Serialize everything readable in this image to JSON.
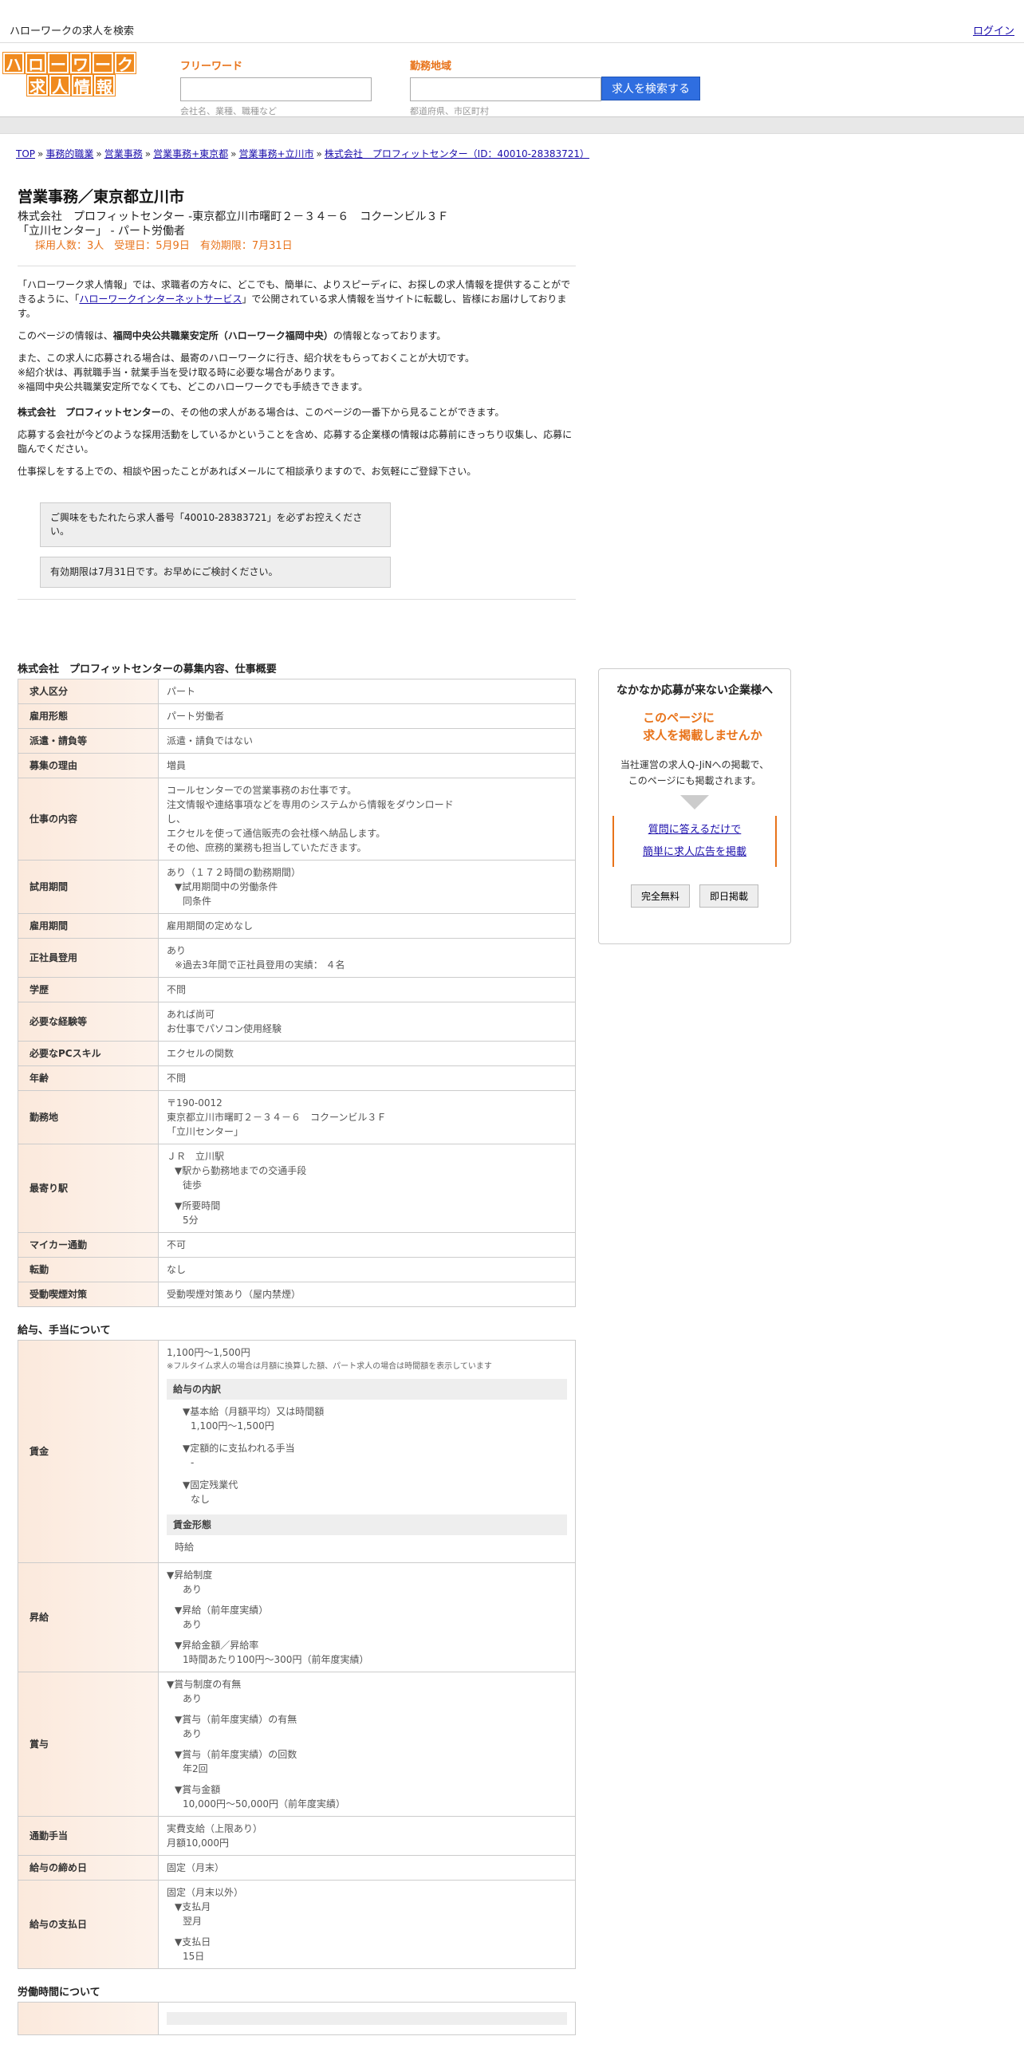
{
  "top": {
    "title": "ハローワークの求人を検索",
    "login": "ログイン"
  },
  "logo": {
    "row1": [
      "ハ",
      "ロ",
      "ー",
      "ワ",
      "ー",
      "ク"
    ],
    "row2": [
      "求",
      "人",
      "情",
      "報"
    ]
  },
  "search": {
    "free_label": "フリーワード",
    "free_ph": "会社名、業種、職種など",
    "area_label": "勤務地域",
    "area_ph": "都道府県、市区町村",
    "button": "求人を検索する"
  },
  "breadcrumb": [
    "TOP",
    "事務的職業",
    "営業事務",
    "営業事務+東京都",
    "営業事務+立川市",
    "株式会社　プロフィットセンター（ID：40010-28383721）"
  ],
  "job": {
    "title": "営業事務／東京都立川市",
    "sub1": "株式会社　プロフィットセンター -東京都立川市曙町２－３４－６　コクーンビル３Ｆ",
    "sub2": "「立川センター」 - パート労働者",
    "meta": "採用人数：3人　受理日：5月9日　有効期限：7月31日"
  },
  "intro": {
    "p1a": "「ハローワーク求人情報」では、求職者の方々に、どこでも、簡単に、よりスピーディに、お探しの求人情報を提供することができるように、「",
    "p1link": "ハローワークインターネットサービス",
    "p1b": "」で公開されている求人情報を当サイトに転載し、皆様にお届けしております。",
    "p2a": "このページの情報は、",
    "p2b": "福岡中央公共職業安定所（ハローワーク福岡中央）",
    "p2c": "の情報となっております。",
    "p3": [
      "また、この求人に応募される場合は、最寄のハローワークに行き、紹介状をもらっておくことが大切です。",
      "※紹介状は、再就職手当・就業手当を受け取る時に必要な場合があります。",
      "※福岡中央公共職業安定所でなくても、どこのハローワークでも手続きできます。"
    ],
    "p4a": "株式会社　プロフィットセンター",
    "p4b": "の、その他の求人がある場合は、このページの一番下から見ることができます。",
    "p5": "応募する会社が今どのような採用活動をしているかということを含め、応募する企業様の情報は応募前にきっちり収集し、応募に臨んでください。",
    "p6": "仕事探しをする上での、相談や困ったことがあればメールにて相談承りますので、お気軽にご登録下さい。",
    "n1": "ご興味をもたれたら求人番号「40010-28383721」を必ずお控えください。",
    "n2": "有効期限は7月31日です。お早めにご検討ください。"
  },
  "sec1": {
    "title": "株式会社　プロフィットセンターの募集内容、仕事概要",
    "rows": [
      {
        "k": "求人区分",
        "v": [
          "パート"
        ]
      },
      {
        "k": "雇用形態",
        "v": [
          "パート労働者"
        ]
      },
      {
        "k": "派遣・請負等",
        "v": [
          "派遣・請負ではない"
        ]
      },
      {
        "k": "募集の理由",
        "v": [
          "増員"
        ]
      },
      {
        "k": "仕事の内容",
        "v": [
          "コールセンターでの営業事務のお仕事です。",
          "注文情報や連絡事項などを専用のシステムから情報をダウンロード",
          "し、",
          "エクセルを使って通信販売の会社様へ納品します。",
          "その他、庶務的業務も担当していただきます。"
        ]
      },
      {
        "k": "試用期間",
        "v": [
          "あり（１７２時間の勤務期間）",
          "▼試用期間中の労働条件",
          "同条件"
        ]
      },
      {
        "k": "雇用期間",
        "v": [
          "雇用期間の定めなし"
        ]
      },
      {
        "k": "正社員登用",
        "v": [
          "あり",
          "※過去3年間で正社員登用の実績： ４名"
        ]
      },
      {
        "k": "学歴",
        "v": [
          "不問"
        ]
      },
      {
        "k": "必要な経験等",
        "v": [
          "あれば尚可",
          "お仕事でパソコン使用経験"
        ]
      },
      {
        "k": "必要なPCスキル",
        "v": [
          "エクセルの関数"
        ]
      },
      {
        "k": "年齢",
        "v": [
          "不問"
        ]
      },
      {
        "k": "勤務地",
        "v": [
          "〒190-0012",
          "東京都立川市曙町２－３４－６　コクーンビル３Ｆ",
          "「立川センター」"
        ]
      },
      {
        "k": "最寄り駅",
        "v": [
          "ＪＲ　立川駅",
          "▼駅から勤務地までの交通手段",
          "徒歩",
          "▼所要時間",
          "5分"
        ]
      },
      {
        "k": "マイカー通勤",
        "v": [
          "不可"
        ]
      },
      {
        "k": "転勤",
        "v": [
          "なし"
        ]
      },
      {
        "k": "受動喫煙対策",
        "v": [
          "受動喫煙対策あり（屋内禁煙）"
        ]
      }
    ]
  },
  "sec2": {
    "title": "給与、手当について",
    "wage": {
      "k": "賃金",
      "amount": "1,100円〜1,500円",
      "note": "※フルタイム求人の場合は月額に換算した額、パート求人の場合は時間額を表示しています",
      "box1": "給与の内訳",
      "items": [
        "▼基本給（月額平均）又は時間額",
        "1,100円〜1,500円",
        "▼定額的に支払われる手当",
        "-",
        "▼固定残業代",
        "なし"
      ],
      "box2": "賃金形態",
      "form": "時給"
    },
    "raise": {
      "k": "昇給",
      "v": [
        "▼昇給制度",
        "あり",
        "▼昇給（前年度実績）",
        "あり",
        "▼昇給金額／昇給率",
        "1時間あたり100円〜300円（前年度実績）"
      ]
    },
    "bonus": {
      "k": "賞与",
      "v": [
        "▼賞与制度の有無",
        "あり",
        "▼賞与（前年度実績）の有無",
        "あり",
        "▼賞与（前年度実績）の回数",
        "年2回",
        "▼賞与金額",
        "10,000円〜50,000円（前年度実績）"
      ]
    },
    "commute": {
      "k": "通勤手当",
      "v": [
        "実費支給（上限あり）",
        "月額10,000円"
      ]
    },
    "close": {
      "k": "給与の締め日",
      "v": [
        "固定（月末）"
      ]
    },
    "pay": {
      "k": "給与の支払日",
      "v": [
        "固定（月末以外）",
        "▼支払月",
        "翌月",
        "▼支払日",
        "15日"
      ]
    }
  },
  "sec3": {
    "title": "労働時間について"
  },
  "ad": {
    "head": "なかなか応募が来ない企業様へ",
    "o1": "このページに",
    "o2": "求人を掲載しませんか",
    "d1": "当社運営の求人Q-JiNへの掲載で、",
    "d2": "このページにも掲載されます。",
    "l1": "質問に答えるだけで",
    "l2": "簡単に求人広告を掲載",
    "b1": "完全無料",
    "b2": "即日掲載"
  }
}
